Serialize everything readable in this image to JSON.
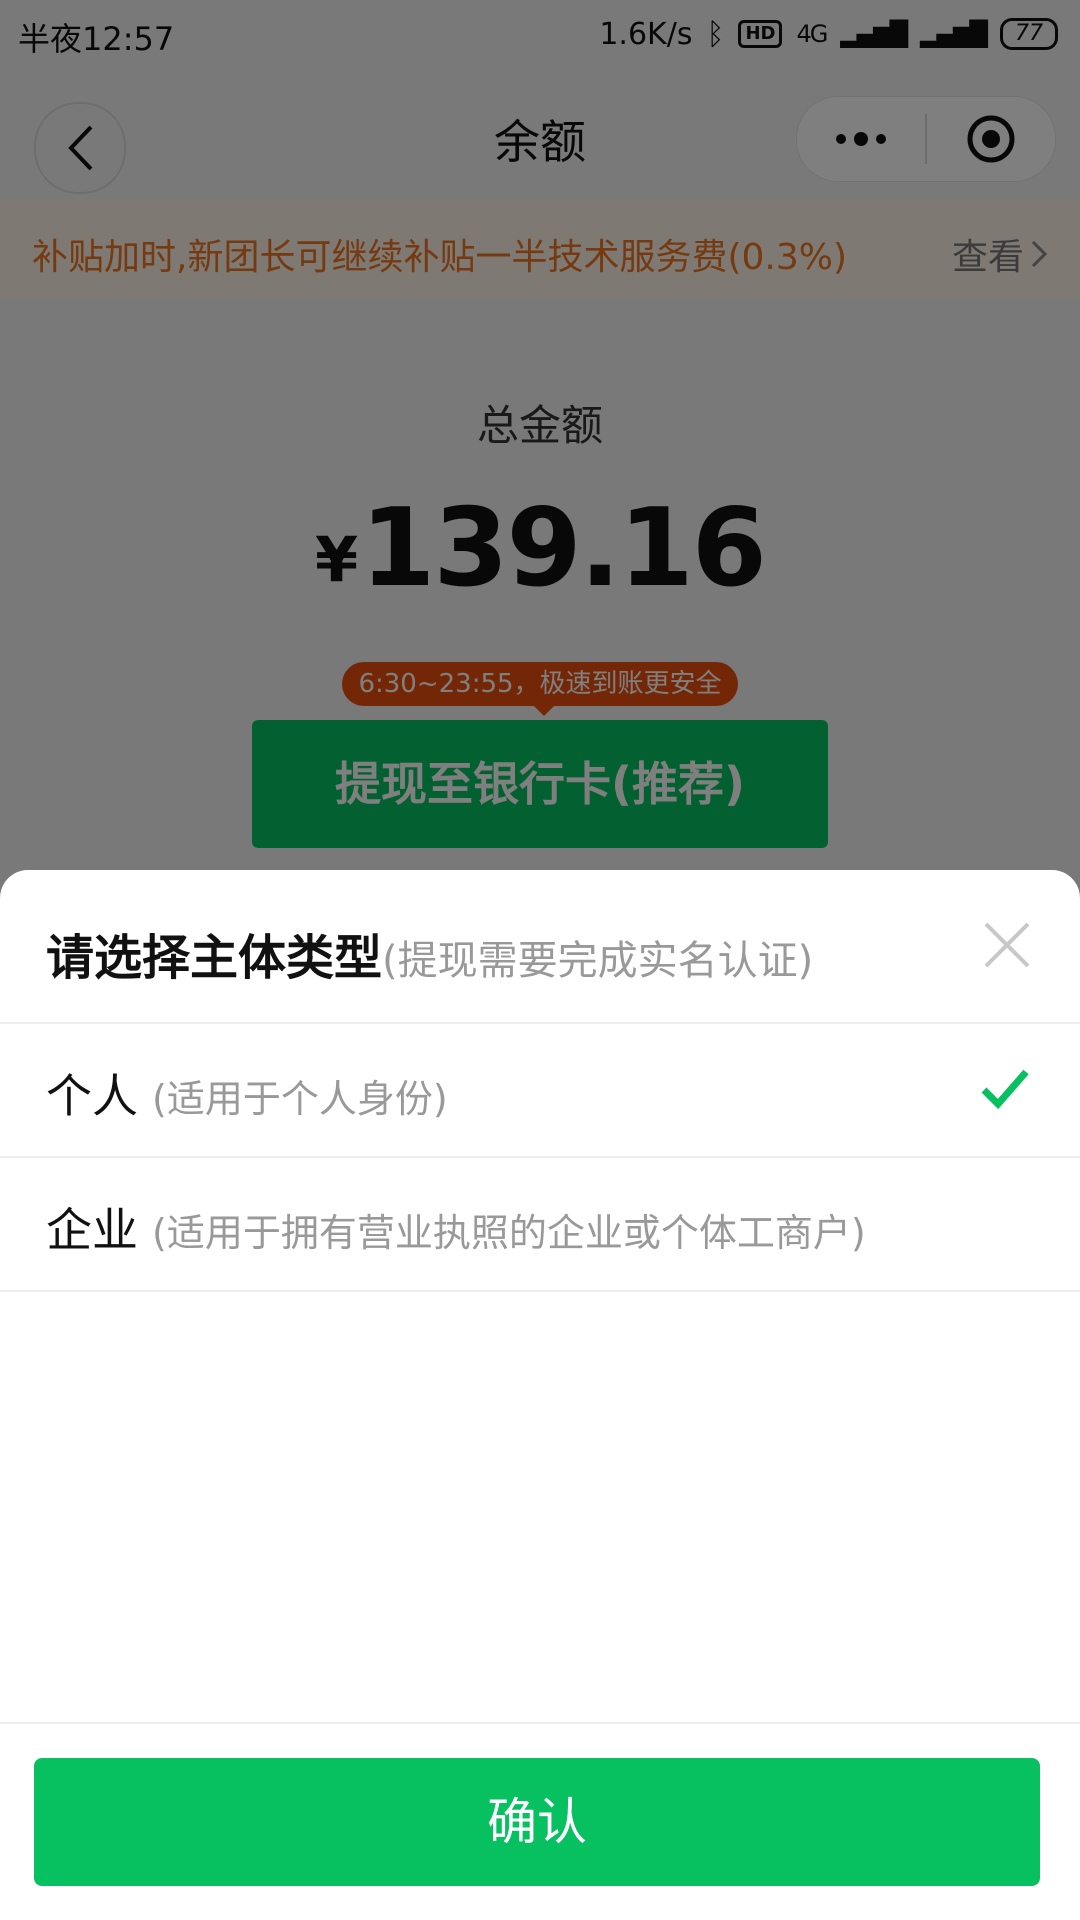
{
  "status_bar": {
    "time": "半夜12:57",
    "net_speed": "1.6K/s",
    "hd": "HD",
    "network": "4G",
    "battery": "77"
  },
  "nav": {
    "title": "余额"
  },
  "notice": {
    "text": "补贴加时,新团长可继续补贴一半技术服务费(0.3%)",
    "link": "查看"
  },
  "balance": {
    "label": "总金额",
    "currency": "¥",
    "amount": "139.16"
  },
  "tooltip": {
    "text": "6:30~23:55，极速到账更安全"
  },
  "withdraw_button": "提现至银行卡(推荐)",
  "sheet": {
    "title": "请选择主体类型",
    "subtitle": "(提现需要完成实名认证)",
    "options": [
      {
        "label": "个人",
        "desc": "(适用于个人身份)",
        "selected": true
      },
      {
        "label": "企业",
        "desc": "(适用于拥有营业执照的企业或个体工商户)",
        "selected": false
      }
    ],
    "confirm": "确认"
  },
  "colors": {
    "accent": "#07c160",
    "notice_text": "#ea7422",
    "tooltip_bg": "#e84e0c"
  }
}
